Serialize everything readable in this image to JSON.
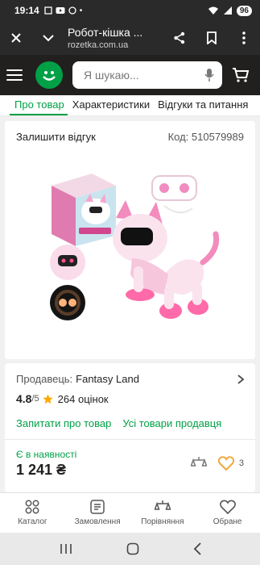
{
  "status_bar": {
    "time": "19:14",
    "battery": "96"
  },
  "browser": {
    "page_title": "Робот-кішка ...",
    "url": "rozetka.com.ua"
  },
  "header": {
    "search_placeholder": "Я шукаю..."
  },
  "tabs": [
    {
      "label": "Про товар",
      "active": true
    },
    {
      "label": "Характеристики",
      "active": false
    },
    {
      "label": "Відгуки та питання",
      "active": false
    }
  ],
  "product": {
    "leave_review": "Залишити відгук",
    "code_label": "Код:",
    "code_value": "510579989",
    "image_icon": "robot-cat-product-image"
  },
  "seller": {
    "label": "Продавець:",
    "name": "Fantasy Land",
    "rating": "4.8",
    "rating_max": "/5",
    "reviews": "264 оцінок",
    "ask_link": "Запитати про товар",
    "all_goods_link": "Усі товари продавця",
    "availability": "Є в наявності",
    "price": "1 241 ₴",
    "favorites_count": "3"
  },
  "bottom_nav": [
    {
      "label": "Каталог",
      "icon": "catalog-icon"
    },
    {
      "label": "Замовлення",
      "icon": "orders-icon"
    },
    {
      "label": "Порівняння",
      "icon": "compare-icon"
    },
    {
      "label": "Обране",
      "icon": "heart-icon"
    }
  ],
  "colors": {
    "green": "#00a046",
    "dark": "#221f1f",
    "star": "#ffa900",
    "heart": "#f0a93b",
    "pink": "#ff5fa2"
  }
}
